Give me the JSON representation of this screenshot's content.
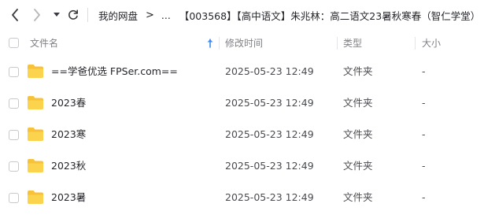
{
  "toolbar": {
    "back_icon": "chevron-left-icon",
    "forward_icon": "chevron-right-icon",
    "dropdown_icon": "caret-down-icon",
    "refresh_icon": "refresh-icon"
  },
  "breadcrumb": {
    "root": "我的网盘",
    "separator": ">",
    "ellipsis": "...",
    "current": "【003568】【高中语文】朱兆林：高二语文23暑秋寒春（智仁学堂）"
  },
  "table": {
    "headers": {
      "name": "文件名",
      "mtime": "修改时间",
      "type": "类型",
      "size": "大小"
    },
    "sort_icon": "sort-up-arrow-icon",
    "sort_color": "#3c8cf0",
    "folder_color": "#f7c239",
    "rows": [
      {
        "name": "==学爸优选 FPSer.com==",
        "mtime": "2025-05-23 12:49",
        "type": "文件夹",
        "size": "-"
      },
      {
        "name": "2023春",
        "mtime": "2025-05-23 12:49",
        "type": "文件夹",
        "size": "-"
      },
      {
        "name": "2023寒",
        "mtime": "2025-05-23 12:49",
        "type": "文件夹",
        "size": "-"
      },
      {
        "name": "2023秋",
        "mtime": "2025-05-23 12:49",
        "type": "文件夹",
        "size": "-"
      },
      {
        "name": "2023暑",
        "mtime": "2025-05-23 12:49",
        "type": "文件夹",
        "size": "-"
      }
    ]
  }
}
